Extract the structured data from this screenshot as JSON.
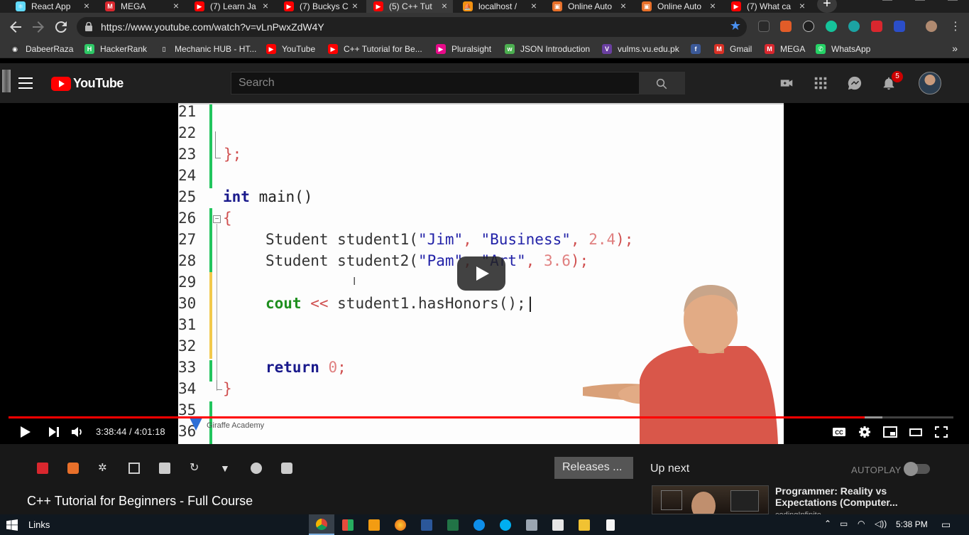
{
  "browser": {
    "tabs": [
      {
        "title": "React App",
        "color": "#61dafb",
        "glyph": "⚛"
      },
      {
        "title": "MEGA",
        "color": "#d9272e",
        "glyph": "M"
      },
      {
        "title": "(7) Learn Ja",
        "color": "#ff0000",
        "glyph": "▶"
      },
      {
        "title": "(7) Buckys C",
        "color": "#ff0000",
        "glyph": "▶"
      },
      {
        "title": "(5) C++ Tut",
        "color": "#ff0000",
        "glyph": "▶"
      },
      {
        "title": "localhost /",
        "color": "#f29111",
        "glyph": "⛵"
      },
      {
        "title": "Online Auto",
        "color": "#e8702a",
        "glyph": "▣"
      },
      {
        "title": "Online Auto",
        "color": "#e8702a",
        "glyph": "▣"
      },
      {
        "title": "(7) What ca",
        "color": "#ff0000",
        "glyph": "▶"
      }
    ],
    "active_tab_index": 4,
    "url": "https://www.youtube.com/watch?v=vLnPwxZdW4Y",
    "bookmarks": [
      {
        "label": "DabeerRaza",
        "color": "#333333",
        "glyph": "◉"
      },
      {
        "label": "HackerRank",
        "color": "#2ec866",
        "glyph": "H"
      },
      {
        "label": "Mechanic HUB - HT...",
        "color": "#353535",
        "glyph": "▯"
      },
      {
        "label": "YouTube",
        "color": "#ff0000",
        "glyph": "▶"
      },
      {
        "label": "C++ Tutorial for Be...",
        "color": "#ff0000",
        "glyph": "▶"
      },
      {
        "label": "Pluralsight",
        "color": "#e80a89",
        "glyph": "▶"
      },
      {
        "label": "JSON Introduction",
        "color": "#4caf50",
        "glyph": "w"
      },
      {
        "label": "vulms.vu.edu.pk",
        "color": "#6a3fa0",
        "glyph": "V"
      },
      {
        "label": "",
        "color": "#3b5998",
        "glyph": "f"
      },
      {
        "label": "Gmail",
        "color": "#d93025",
        "glyph": "M"
      },
      {
        "label": "MEGA",
        "color": "#d9272e",
        "glyph": "M"
      },
      {
        "label": "WhatsApp",
        "color": "#25d366",
        "glyph": "✆"
      }
    ],
    "bookmarks_more": "»"
  },
  "youtube": {
    "logo_text": "YouTube",
    "search_placeholder": "Search",
    "notification_count": "5",
    "player": {
      "current_time": "3:38:44",
      "duration": "4:01:18",
      "time_display": "3:38:44 / 4:01:18",
      "progress_fraction": 0.906,
      "buffered_fraction": 0.925,
      "watermark": "Giraffe Academy",
      "code_lines": [
        {
          "no": "21"
        },
        {
          "no": "22"
        },
        {
          "no": "23"
        },
        {
          "no": "24"
        },
        {
          "no": "25"
        },
        {
          "no": "26"
        },
        {
          "no": "27"
        },
        {
          "no": "28"
        },
        {
          "no": "29"
        },
        {
          "no": "30"
        },
        {
          "no": "31"
        },
        {
          "no": "32"
        },
        {
          "no": "33"
        },
        {
          "no": "34"
        },
        {
          "no": "35"
        },
        {
          "no": "36"
        }
      ],
      "code": {
        "l23": "};",
        "l25_kw": "int",
        "l25_rest": " main()",
        "l26": "{",
        "l27_a": "Student student1(",
        "l27_s1": "\"Jim\"",
        "l27_b": ", ",
        "l27_s2": "\"Business\"",
        "l27_c": ", ",
        "l27_n": "2.4",
        "l27_d": ");",
        "l28_a": "Student student2(",
        "l28_s1": "\"Pam\"",
        "l28_b": ", ",
        "l28_s2": "\"Art\"",
        "l28_c": ", ",
        "l28_n": "3.6",
        "l28_d": ");",
        "l30_kw": "cout",
        "l30_op": " << ",
        "l30_rest": "student1.hasHonors();",
        "l33_kw": "return",
        "l33_n": " 0",
        "l33_d": ";",
        "l34": "}"
      }
    },
    "below": {
      "releases_button": "Releases ...",
      "up_next": "Up next",
      "autoplay": "AUTOPLAY",
      "video_title": "C++ Tutorial for Beginners - Full Course",
      "recommended": {
        "title": "Programmer: Reality vs Expectations (Computer...",
        "channel": "codingInfinite"
      }
    }
  },
  "taskbar": {
    "links_label": "Links",
    "clock": "5:38 PM"
  }
}
